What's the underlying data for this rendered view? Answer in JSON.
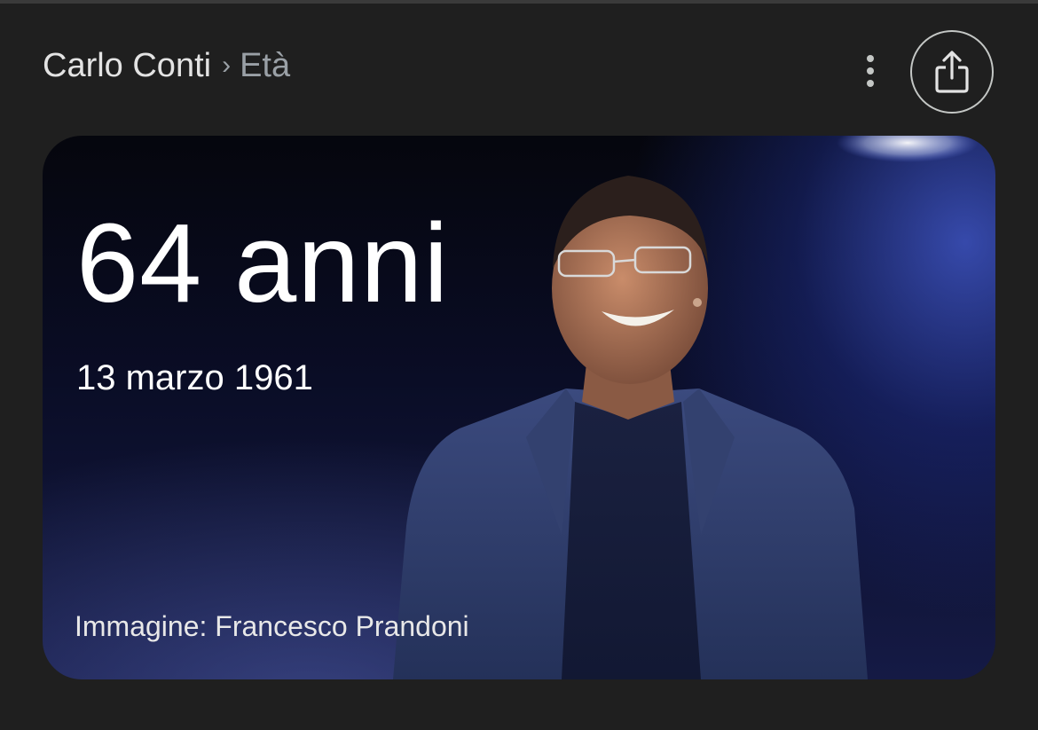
{
  "header": {
    "breadcrumb": {
      "main": "Carlo Conti",
      "separator": "›",
      "current": "Età"
    },
    "more_icon": "more-vert-icon",
    "share_icon": "share-icon"
  },
  "card": {
    "age": "64 anni",
    "birth_date": "13 marzo 1961",
    "image_credit": "Immagine: Francesco Prandoni"
  },
  "colors": {
    "background": "#1f1f1f",
    "breadcrumb_main": "#e3e3e3",
    "breadcrumb_current": "#9aa0a6",
    "card_text": "#ffffff",
    "stage_light": "#4660dc"
  }
}
